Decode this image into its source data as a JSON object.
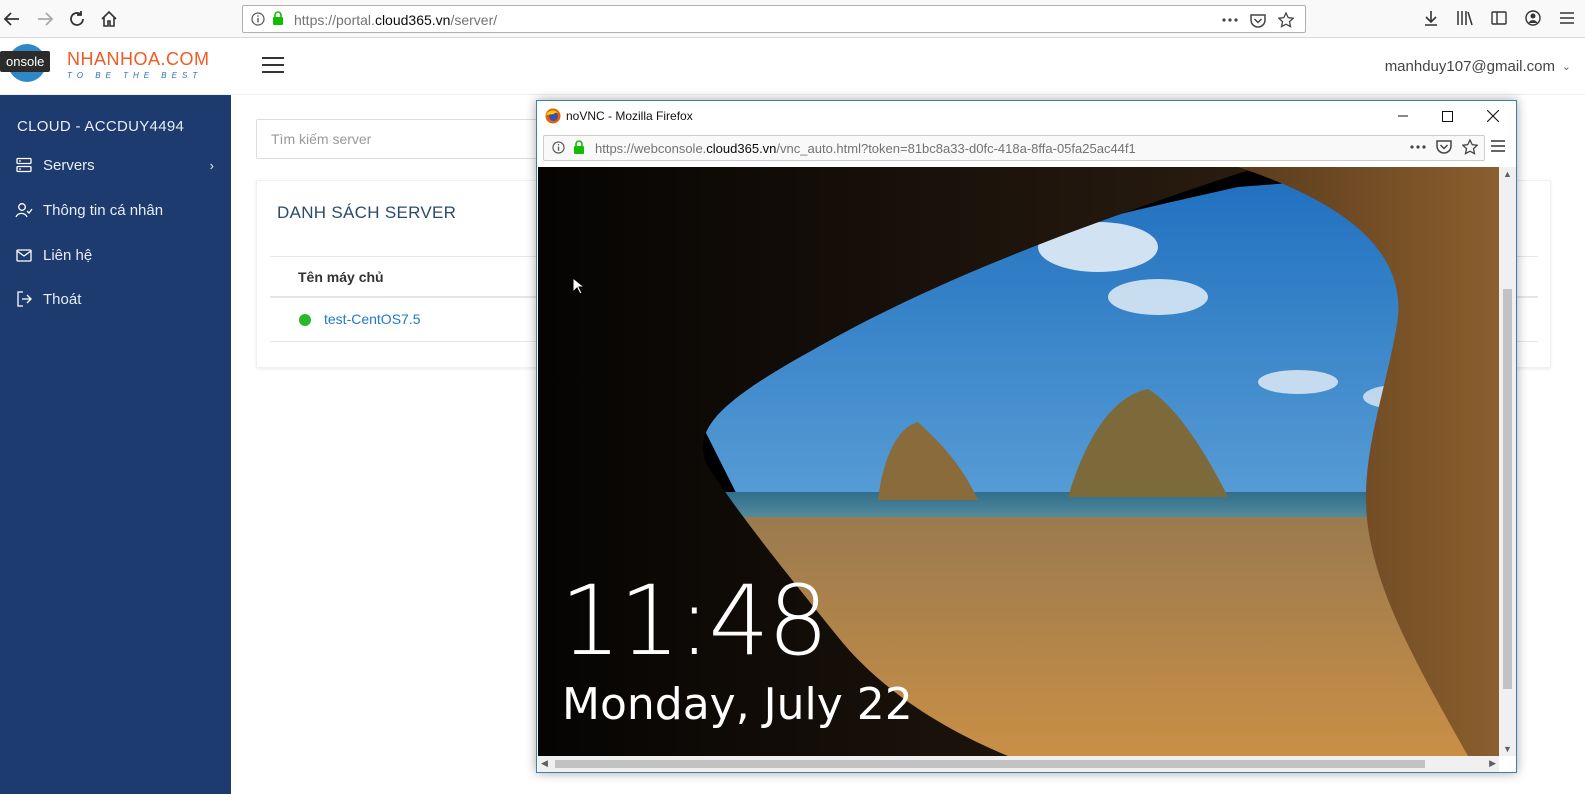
{
  "browser": {
    "url_prefix": "https://portal.",
    "url_domain": "cloud365.vn",
    "url_path": "/server/"
  },
  "portal": {
    "tooltip": "onsole",
    "logo_text": "NHANHOA.COM",
    "logo_tagline": "TO BE THE BEST",
    "user_email": "manhduy107@gmail.com"
  },
  "sidebar": {
    "title": "CLOUD - ACCDUY4494",
    "items": [
      {
        "label": "Servers",
        "icon": "server-icon"
      },
      {
        "label": "Thông tin cá nhân",
        "icon": "user-icon"
      },
      {
        "label": "Liên hệ",
        "icon": "mail-icon"
      },
      {
        "label": "Thoát",
        "icon": "logout-icon"
      }
    ]
  },
  "main": {
    "search_placeholder": "Tìm kiếm server",
    "card_title": "DANH SÁCH SERVER",
    "table_header": "Tên máy chủ",
    "rows": [
      {
        "name": "test-CentOS7.5",
        "status_color": "#28b828"
      }
    ]
  },
  "popup": {
    "title": "noVNC - Mozilla Firefox",
    "url_prefix": "https://webconsole.",
    "url_domain": "cloud365.vn",
    "url_path": "/vnc_auto.html?token=81bc8a33-d0fc-418a-8ffa-05fa25ac44f1",
    "lock_time": "11:48",
    "lock_date": "Monday, July 22"
  },
  "colors": {
    "sidebar_bg": "#1d3b6e",
    "link": "#1f7ac9",
    "brand_orange": "#f15a24"
  }
}
